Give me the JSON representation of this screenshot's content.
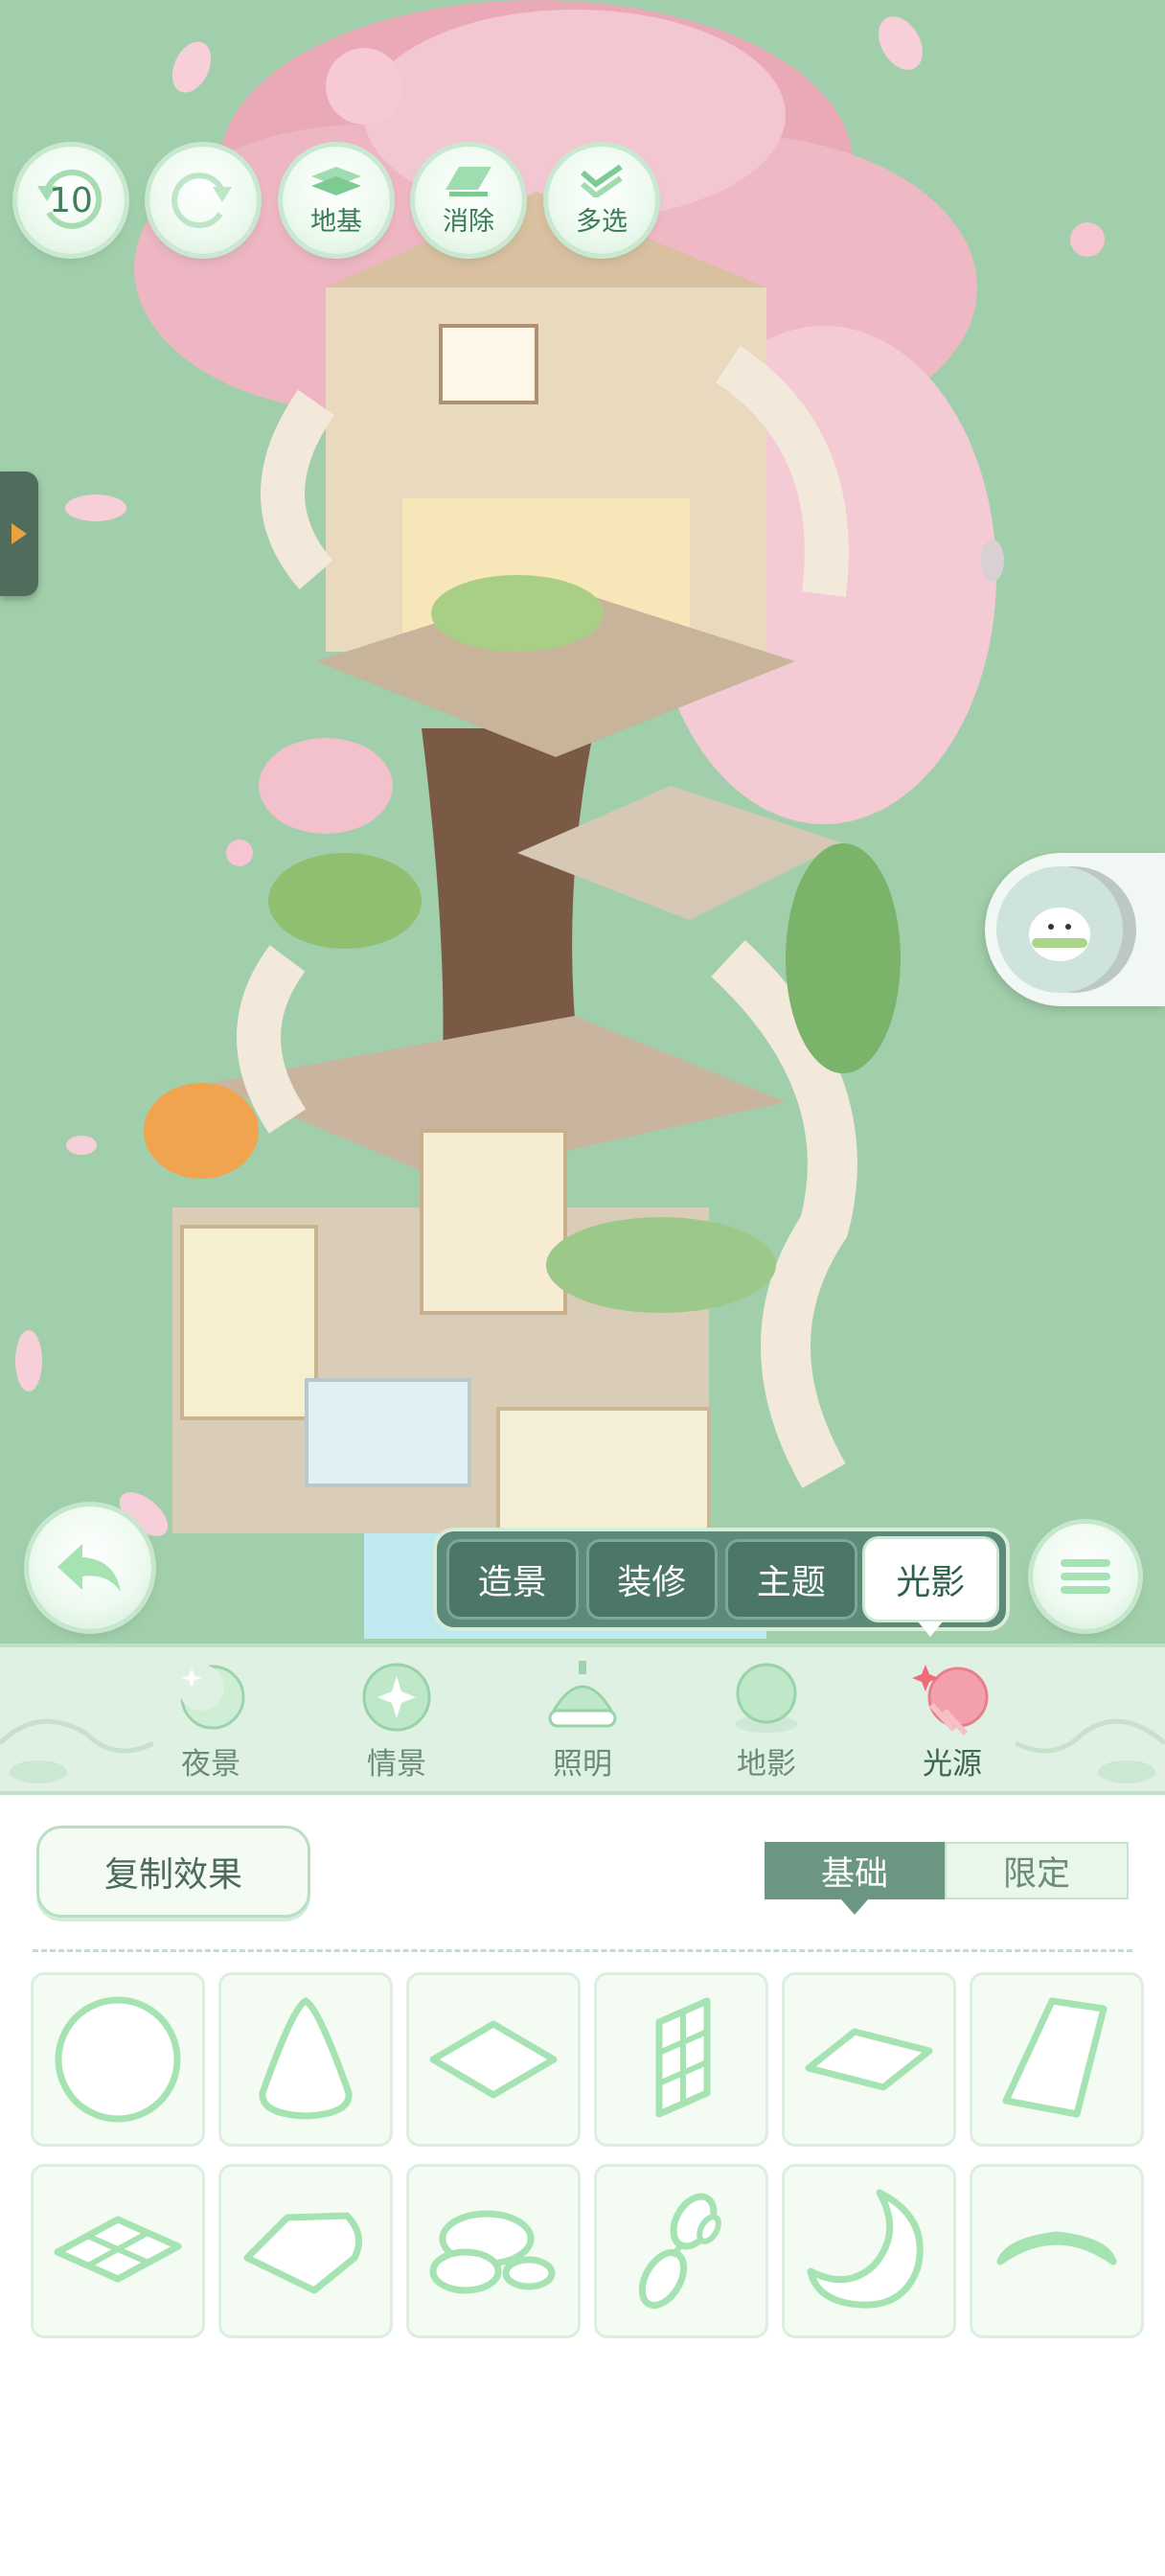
{
  "toolbar": {
    "undo_count": "10",
    "buttons": [
      {
        "label": "地基",
        "icon": "foundation-icon"
      },
      {
        "label": "消除",
        "icon": "eraser-icon"
      },
      {
        "label": "多选",
        "icon": "multi-select-icon"
      }
    ]
  },
  "mode_tabs": [
    {
      "label": "造景",
      "active": false
    },
    {
      "label": "装修",
      "active": false
    },
    {
      "label": "主题",
      "active": false
    },
    {
      "label": "光影",
      "active": true
    }
  ],
  "categories": [
    {
      "label": "夜景",
      "icon": "moon-icon",
      "active": false
    },
    {
      "label": "情景",
      "icon": "sparkle-orb-icon",
      "active": false
    },
    {
      "label": "照明",
      "icon": "lamp-icon",
      "active": false
    },
    {
      "label": "地影",
      "icon": "ground-shadow-icon",
      "active": false
    },
    {
      "label": "光源",
      "icon": "light-source-icon",
      "active": true
    }
  ],
  "panel": {
    "copy_effect": "复制效果",
    "segment": {
      "basic": "基础",
      "limited": "限定",
      "selected": "基础"
    }
  },
  "shapes": [
    "circle-shape-icon",
    "cone-shape-icon",
    "diamond-shape-icon",
    "window-shape-icon",
    "flat-diamond-shape-icon",
    "trapezoid-shape-icon",
    "grid-tile-shape-icon",
    "kite-shape-icon",
    "cloud-shape-icon",
    "bubbles-shape-icon",
    "crescent-shape-icon",
    "arc-shape-icon"
  ],
  "colors": {
    "scene_bg": "#a2cfab",
    "accent_green": "#5c8a78",
    "outline_green": "#a6e3b2",
    "blossom_pink": "#f2b8c6"
  }
}
